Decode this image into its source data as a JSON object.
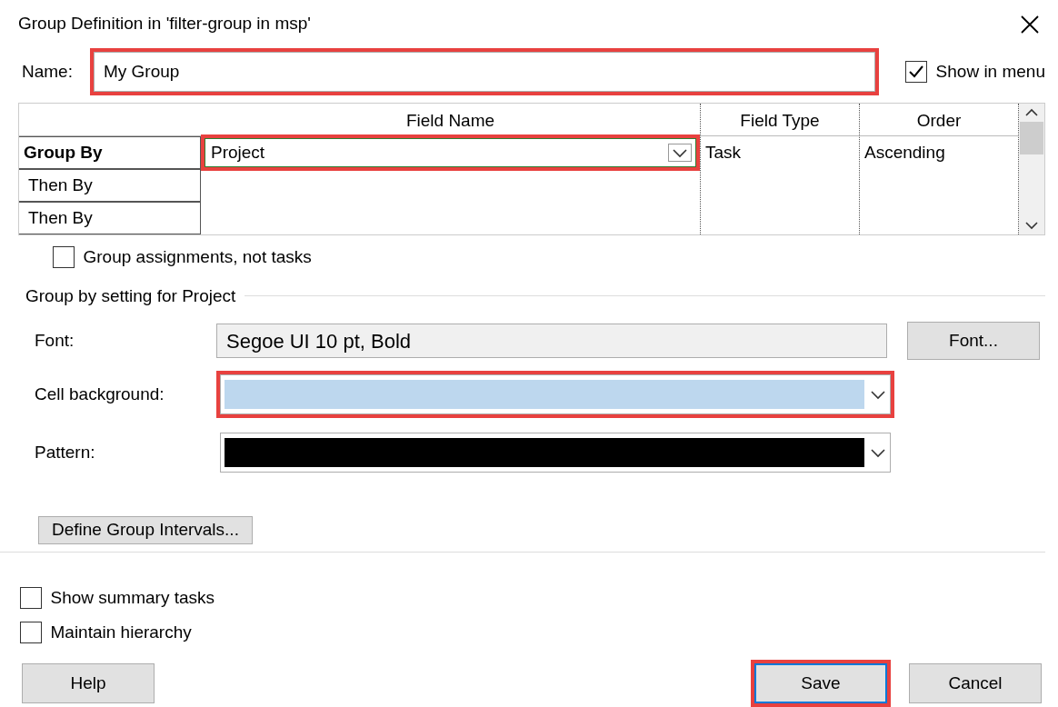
{
  "window": {
    "title": "Group Definition in 'filter-group in msp'"
  },
  "name_field": {
    "label": "Name:",
    "value": "My Group",
    "highlighted": true
  },
  "show_in_menu": {
    "label": "Show in menu",
    "checked": true
  },
  "grid": {
    "columns": [
      "Field Name",
      "Field Type",
      "Order"
    ],
    "rows": [
      {
        "header": "Group By",
        "field_name": "Project",
        "field_type": "Task",
        "order": "Ascending",
        "selected": true,
        "highlighted": true
      },
      {
        "header": "Then By",
        "selected": false,
        "highlighted": false
      },
      {
        "header": "Then By",
        "selected": false,
        "highlighted": false
      }
    ]
  },
  "group_assignments": {
    "label": "Group assignments, not tasks",
    "checked": false
  },
  "settings": {
    "title": "Group by setting for Project",
    "font": {
      "label": "Font:",
      "value": "Segoe UI 10 pt, Bold",
      "button": "Font..."
    },
    "cell_background": {
      "label": "Cell background:",
      "color": "#bdd7ee",
      "highlighted": true
    },
    "pattern": {
      "label": "Pattern:",
      "color": "#000000",
      "highlighted": false
    }
  },
  "define_button": "Define Group Intervals...",
  "options": [
    {
      "label": "Show summary tasks",
      "checked": false
    },
    {
      "label": "Maintain hierarchy",
      "checked": false
    }
  ],
  "buttons": [
    {
      "label": "Help",
      "default": false,
      "highlighted": false
    },
    {
      "label": "Save",
      "default": true,
      "highlighted": true
    },
    {
      "label": "Cancel",
      "default": false,
      "highlighted": false
    }
  ]
}
